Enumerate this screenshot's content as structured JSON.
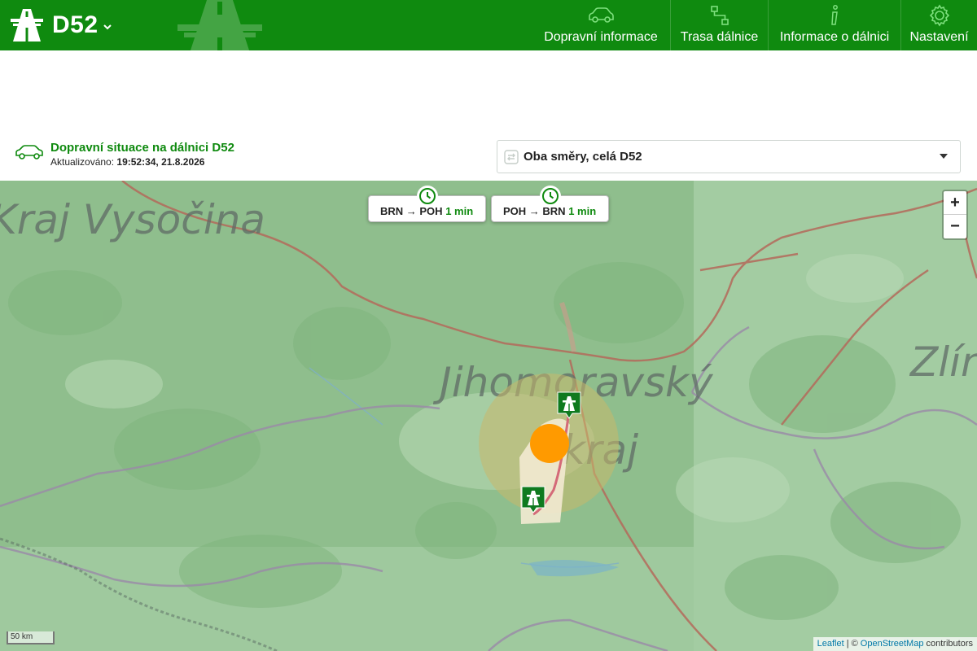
{
  "header": {
    "road_name": "D52",
    "nav": [
      {
        "label": "Dopravní informace",
        "icon": "car-icon"
      },
      {
        "label": "Trasa dálnice",
        "icon": "route-icon"
      },
      {
        "label": "Informace o dálnici",
        "icon": "info-icon"
      },
      {
        "label": "Nastavení",
        "icon": "gear-icon"
      }
    ]
  },
  "status": {
    "title": "Dopravní situace na dálnici D52",
    "updated_label": "Aktualizováno:",
    "updated_value": "19:52:34, 21.8.2026"
  },
  "direction_select": {
    "selected": "Oba směry, celá D52"
  },
  "map": {
    "region_labels": [
      "Kraj Vysočina",
      "Jihomoravský kraj",
      "Zlín"
    ],
    "travel_times": [
      {
        "route": "BRN → POH",
        "time": "1 min"
      },
      {
        "route": "POH → BRN",
        "time": "1 min"
      }
    ],
    "zoom_in": "+",
    "zoom_out": "−",
    "scale": "50 km",
    "attribution": {
      "leaflet": "Leaflet",
      "separator": "| ©",
      "osm": "OpenStreetMap",
      "suffix": "contributors"
    }
  },
  "colors": {
    "brand_green": "#0f8a0f",
    "incident_orange": "#ff9a00",
    "map_green": "#9cc79b"
  }
}
